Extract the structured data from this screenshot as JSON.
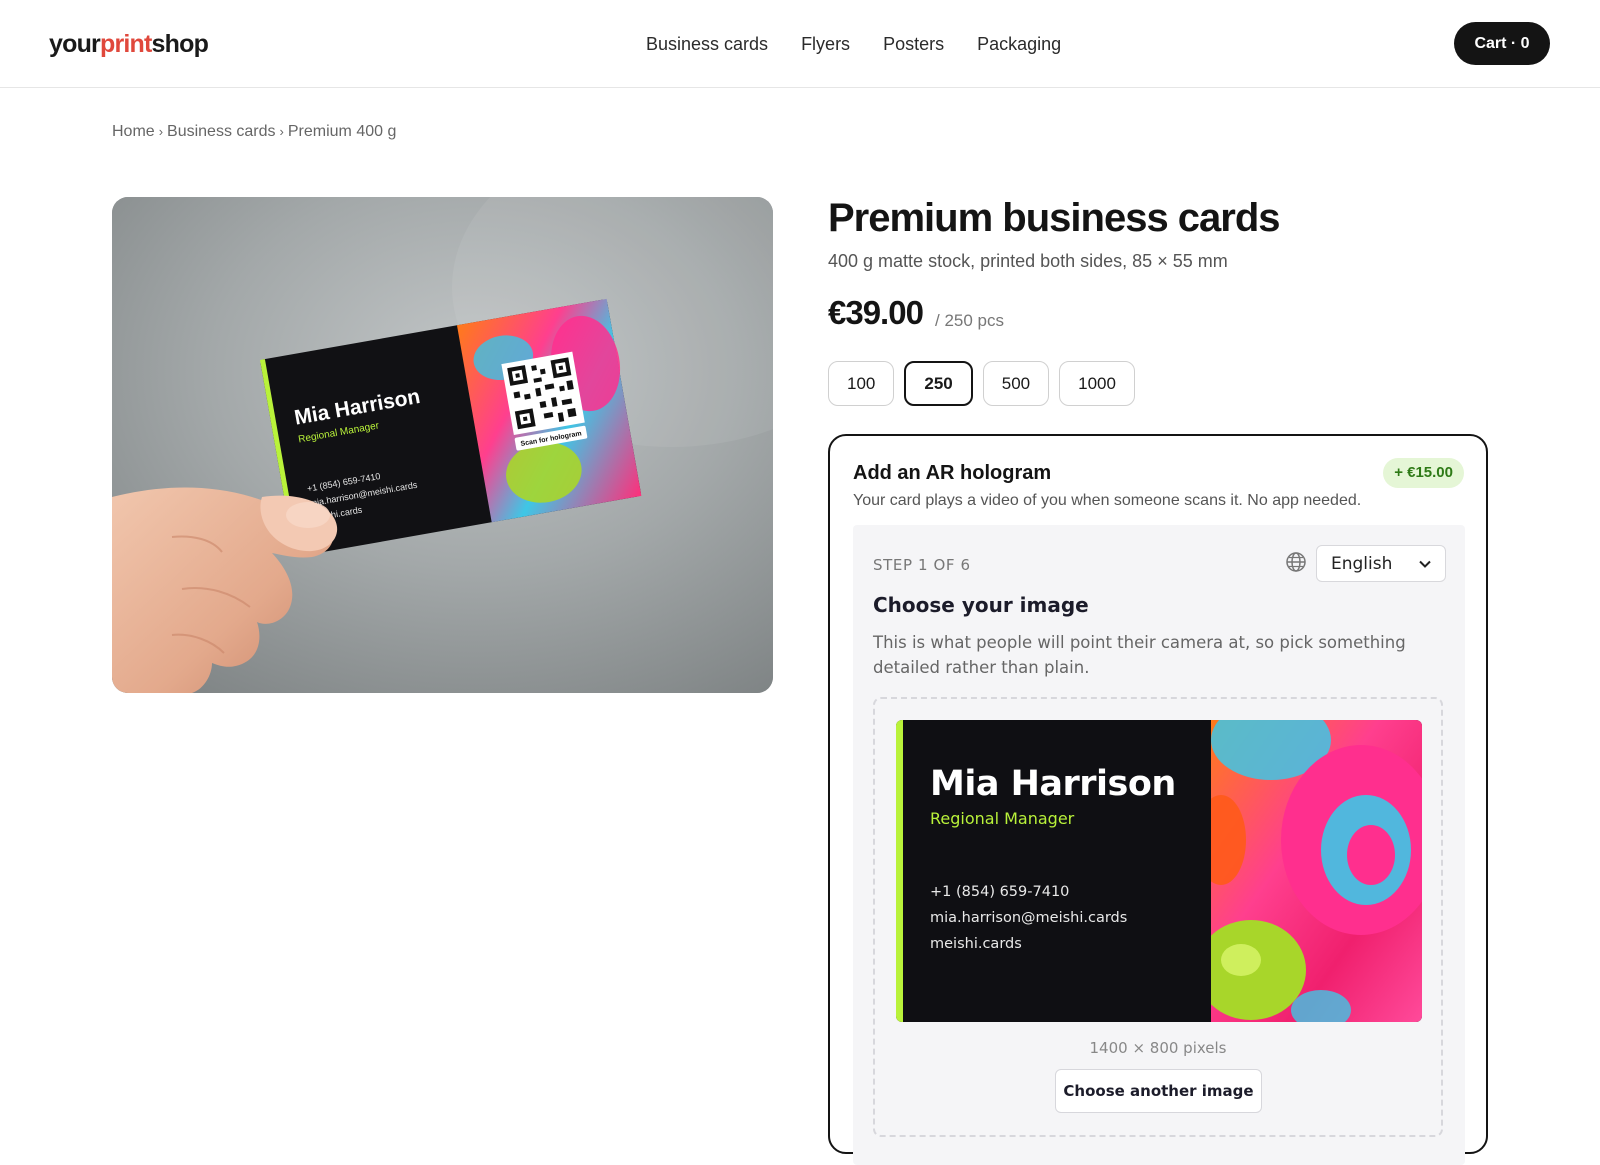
{
  "header": {
    "logo": {
      "part1": "your",
      "part2": "print",
      "part3": "shop"
    },
    "nav": [
      "Business cards",
      "Flyers",
      "Posters",
      "Packaging"
    ],
    "cart_label": "Cart · 0"
  },
  "breadcrumb": [
    "Home",
    "Business cards",
    "Premium 400 g"
  ],
  "breadcrumb_separator": "›",
  "product": {
    "title": "Premium business cards",
    "subtitle": "400 g matte stock, printed both sides, 85 × 55 mm",
    "price": "€39.00",
    "price_unit": "/ 250 pcs",
    "quantities": [
      "100",
      "250",
      "500",
      "1000"
    ],
    "selected_quantity": "250"
  },
  "hero_card": {
    "name": "Mia Harrison",
    "role": "Regional Manager",
    "phone": "+1 (854) 659-7410",
    "email": "mia.harrison@meishi.cards",
    "website": "meishi.cards",
    "qr_caption": "Scan for hologram"
  },
  "ar": {
    "title": "Add an AR hologram",
    "description": "Your card plays a video of you when someone scans it. No app needed.",
    "price_badge": "+ €15.00",
    "step_label": "STEP 1 OF 6",
    "language": "English",
    "heading": "Choose your image",
    "text": "This is what people will point their camera at, so pick something detailed rather than plain.",
    "preview": {
      "name": "Mia Harrison",
      "role": "Regional Manager",
      "phone": "+1 (854) 659-7410",
      "email": "mia.harrison@meishi.cards",
      "website": "meishi.cards"
    },
    "dimensions": "1400 × 800 pixels",
    "choose_button": "Choose another image"
  },
  "colors": {
    "brand_accent": "#e0483c",
    "card_stripe": "#b9f23a",
    "badge_bg": "#e5f6d6",
    "badge_text": "#2e7a16",
    "dark": "#141414"
  },
  "icons": {
    "globe": "globe-icon",
    "chevron": "chevron-down-icon"
  }
}
